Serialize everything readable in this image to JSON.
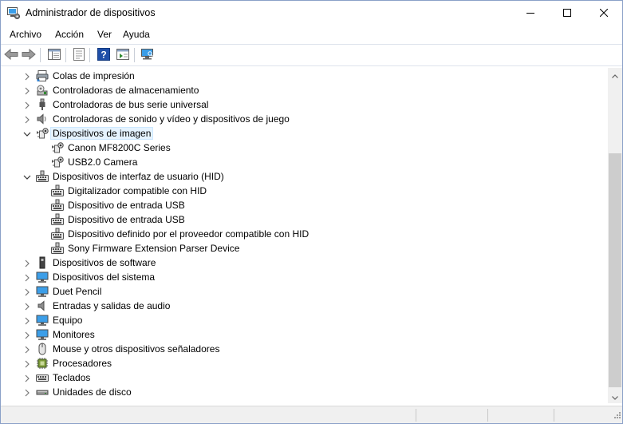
{
  "window": {
    "title": "Administrador de dispositivos",
    "controls": [
      "minimize",
      "maximize",
      "close"
    ]
  },
  "menu": [
    "Archivo",
    "Acción",
    "Ver",
    "Ayuda"
  ],
  "toolbar": {
    "buttons": [
      "back-arrow-icon",
      "forward-arrow-icon",
      "show-hide-tree-icon",
      "properties-icon",
      "help-icon",
      "action-view-icon",
      "scan-hardware-icon"
    ]
  },
  "tree": {
    "selected": "Dispositivos de imagen",
    "items": [
      {
        "label": "Colas de impresión",
        "level": 0,
        "state": "collapsed",
        "icon": "print-queue-icon"
      },
      {
        "label": "Controladoras de almacenamiento",
        "level": 0,
        "state": "collapsed",
        "icon": "storage-controller-icon"
      },
      {
        "label": "Controladoras de bus serie universal",
        "level": 0,
        "state": "collapsed",
        "icon": "usb-controller-icon"
      },
      {
        "label": "Controladoras de sonido y vídeo y dispositivos de juego",
        "level": 0,
        "state": "collapsed",
        "icon": "sound-icon"
      },
      {
        "label": "Dispositivos de imagen",
        "level": 0,
        "state": "expanded",
        "icon": "camera-icon"
      },
      {
        "label": "Canon MF8200C Series",
        "level": 1,
        "state": "leaf",
        "icon": "camera-icon"
      },
      {
        "label": "USB2.0 Camera",
        "level": 1,
        "state": "leaf",
        "icon": "camera-icon"
      },
      {
        "label": "Dispositivos de interfaz de usuario (HID)",
        "level": 0,
        "state": "expanded",
        "icon": "hid-icon"
      },
      {
        "label": "Digitalizador compatible con HID",
        "level": 1,
        "state": "leaf",
        "icon": "hid-icon"
      },
      {
        "label": "Dispositivo de entrada USB",
        "level": 1,
        "state": "leaf",
        "icon": "hid-icon"
      },
      {
        "label": "Dispositivo de entrada USB",
        "level": 1,
        "state": "leaf",
        "icon": "hid-icon"
      },
      {
        "label": "Dispositivo definido por el proveedor compatible con HID",
        "level": 1,
        "state": "leaf",
        "icon": "hid-icon"
      },
      {
        "label": "Sony Firmware Extension Parser Device",
        "level": 1,
        "state": "leaf",
        "icon": "hid-icon"
      },
      {
        "label": "Dispositivos de software",
        "level": 0,
        "state": "collapsed",
        "icon": "software-device-icon"
      },
      {
        "label": "Dispositivos del sistema",
        "level": 0,
        "state": "collapsed",
        "icon": "system-device-icon"
      },
      {
        "label": "Duet Pencil",
        "level": 0,
        "state": "collapsed",
        "icon": "monitor-icon"
      },
      {
        "label": "Entradas y salidas de audio",
        "level": 0,
        "state": "collapsed",
        "icon": "speaker-icon"
      },
      {
        "label": "Equipo",
        "level": 0,
        "state": "collapsed",
        "icon": "monitor-icon"
      },
      {
        "label": "Monitores",
        "level": 0,
        "state": "collapsed",
        "icon": "monitor-icon"
      },
      {
        "label": "Mouse y otros dispositivos señaladores",
        "level": 0,
        "state": "collapsed",
        "icon": "mouse-icon"
      },
      {
        "label": "Procesadores",
        "level": 0,
        "state": "collapsed",
        "icon": "processor-icon"
      },
      {
        "label": "Teclados",
        "level": 0,
        "state": "collapsed",
        "icon": "keyboard-icon"
      },
      {
        "label": "Unidades de disco",
        "level": 0,
        "state": "collapsed",
        "icon": "disk-drive-icon"
      }
    ]
  },
  "colors": {
    "selection_bg": "#e5f3ff",
    "selection_border": "#cce8ff",
    "help_blue": "#1f4fa8",
    "monitor_blue": "#3c9ee8",
    "scroll_thumb": "#cdcdcd"
  }
}
